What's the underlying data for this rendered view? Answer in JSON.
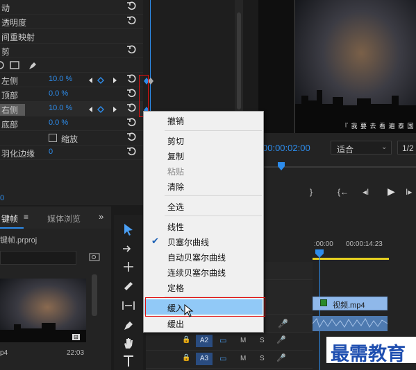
{
  "effect_controls": {
    "rows": [
      {
        "label": "动"
      },
      {
        "label": "透明度"
      },
      {
        "label": "间重映射"
      },
      {
        "label": "剪"
      },
      {
        "label": ""
      },
      {
        "label": "左侧",
        "value": "10.0 %"
      },
      {
        "label": "顶部",
        "value": "0.0 %"
      },
      {
        "label": "右侧",
        "value": "10.0 %"
      },
      {
        "label": "底部",
        "value": "0.0 %"
      },
      {
        "label": "缩放"
      },
      {
        "label": "羽化边缘",
        "value": "0"
      }
    ],
    "bottom_value": "0"
  },
  "monitor": {
    "subtitle": "『 我 要 去 看 遍 泰 国",
    "timecode": "00:00:02:00",
    "fit_label": "适合",
    "fraction_label": "1/2"
  },
  "project_panel": {
    "tabs": [
      "键帧",
      "媒体浏览"
    ],
    "project_file": "键帧.prproj",
    "clip_name_partial": "p4",
    "clip_duration": "22:03"
  },
  "timeline": {
    "ruler_labels": [
      ":00:00",
      "00:00:14:23"
    ],
    "video_clip": "视频.mp4",
    "tracks": [
      {
        "name": "A2",
        "m": "M",
        "s": "S"
      },
      {
        "name": "A3",
        "m": "M",
        "s": "S"
      }
    ]
  },
  "context_menu": {
    "items": [
      {
        "label": "撤销"
      },
      {
        "label": "剪切"
      },
      {
        "label": "复制"
      },
      {
        "label": "粘贴",
        "disabled": true
      },
      {
        "label": "清除"
      },
      {
        "label": "全选"
      },
      {
        "label": "线性"
      },
      {
        "label": "贝塞尔曲线",
        "checked": true
      },
      {
        "label": "自动贝塞尔曲线"
      },
      {
        "label": "连续贝塞尔曲线"
      },
      {
        "label": "定格"
      },
      {
        "label": "缓入",
        "highlighted": true
      },
      {
        "label": "缓出"
      }
    ],
    "checkmark": "✔"
  },
  "watermark": "最需教育",
  "colors": {
    "value_blue": "#2d8ceb",
    "highlight": "#91c9f7",
    "playhead": "#2d8ceb",
    "annotation_red": "#e01010"
  }
}
